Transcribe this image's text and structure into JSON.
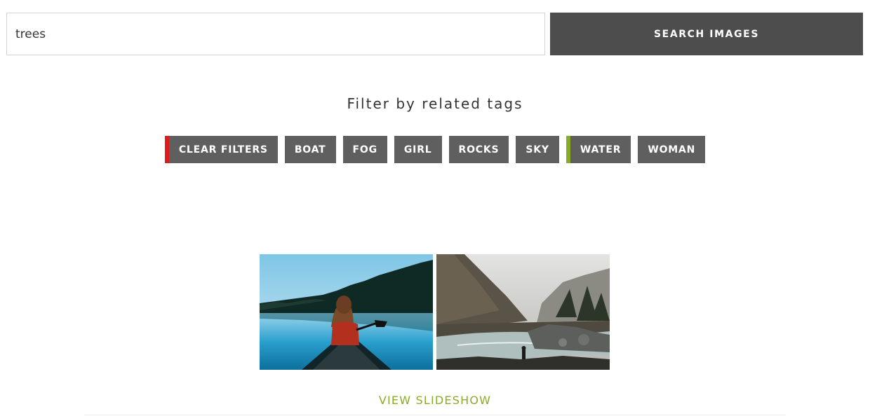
{
  "search": {
    "value": "trees",
    "button_label": "SEARCH IMAGES"
  },
  "filters": {
    "heading": "Filter by related tags",
    "tags": [
      {
        "label": "CLEAR FILTERS",
        "indicator_color": "#e01b1b"
      },
      {
        "label": "BOAT"
      },
      {
        "label": "FOG"
      },
      {
        "label": "GIRL"
      },
      {
        "label": "ROCKS"
      },
      {
        "label": "SKY"
      },
      {
        "label": "WATER",
        "indicator_color": "#8aab2a"
      },
      {
        "label": "WOMAN"
      }
    ]
  },
  "gallery": {
    "images": [
      {
        "name": "girl-in-canoe-on-lake-photo"
      },
      {
        "name": "misty-mountain-river-photo"
      }
    ]
  },
  "slideshow": {
    "label": "VIEW SLIDESHOW"
  },
  "colors": {
    "button_bg": "#4d4d4d",
    "tag_bg": "#5f5f5f",
    "accent_green": "#8aab2a",
    "clear_red": "#e01b1b"
  }
}
